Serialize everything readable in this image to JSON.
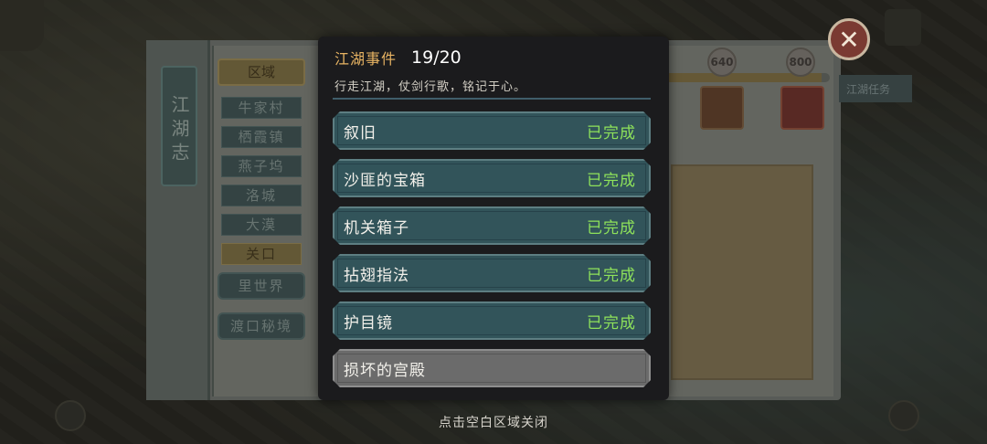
{
  "background": {
    "book_title": "江湖志",
    "regions": {
      "header": "区域",
      "items": [
        "牛家村",
        "栖霞镇",
        "燕子坞",
        "洛城",
        "大漠",
        "关口"
      ],
      "active_index": 5,
      "extra": [
        "里世界",
        "渡口秘境"
      ]
    },
    "milestones": [
      "640",
      "800"
    ],
    "progress_fraction": 0.95,
    "right_tab_label": "江湖任务"
  },
  "modal": {
    "title": "江湖事件",
    "count": "19/20",
    "subtitle": "行走江湖，仗剑行歌，铭记于心。",
    "events": [
      {
        "name": "叙旧",
        "status": "已完成"
      },
      {
        "name": "沙匪的宝箱",
        "status": "已完成"
      },
      {
        "name": "机关箱子",
        "status": "已完成"
      },
      {
        "name": "拈翅指法",
        "status": "已完成"
      },
      {
        "name": "护目镜",
        "status": "已完成"
      },
      {
        "name": "损坏的宫殿",
        "status": ""
      }
    ],
    "colors": {
      "title": "#e8b463",
      "done_status": "#8ee25a",
      "row_done": "#32545a",
      "row_pending": "#6b6b6b"
    }
  },
  "footer_hint": "点击空白区域关闭",
  "icons": {
    "close": "close-icon"
  }
}
